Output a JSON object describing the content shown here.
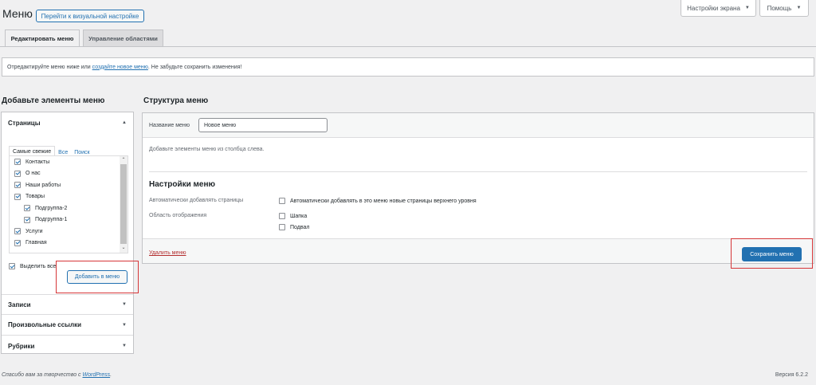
{
  "header": {
    "title": "Меню",
    "live_preview_button": "Перейти к визуальной настройке",
    "screen_options": "Настройки экрана",
    "help": "Помощь"
  },
  "tabs": [
    {
      "label": "Редактировать меню",
      "active": true
    },
    {
      "label": "Управление областями",
      "active": false
    }
  ],
  "notice": {
    "before": "Отредактируйте меню ниже или",
    "link": "создайте новое меню",
    "after": ". Не забудьте сохранить изменения!"
  },
  "left": {
    "heading": "Добавьте элементы меню",
    "pages_section": {
      "title": "Страницы",
      "tabs": [
        "Самые свежие",
        "Все",
        "Поиск"
      ],
      "items": [
        {
          "label": "Контакты",
          "checked": true,
          "level": 0
        },
        {
          "label": "О нас",
          "checked": true,
          "level": 0
        },
        {
          "label": "Наши работы",
          "checked": true,
          "level": 0
        },
        {
          "label": "Товары",
          "checked": true,
          "level": 0
        },
        {
          "label": "Подгруппа-2",
          "checked": true,
          "level": 1
        },
        {
          "label": "Подгруппа-1",
          "checked": true,
          "level": 1
        },
        {
          "label": "Услуги",
          "checked": true,
          "level": 0
        },
        {
          "label": "Главная",
          "checked": true,
          "level": 0
        }
      ],
      "select_all": "Выделить все",
      "add_button": "Добавить в меню"
    },
    "other_sections": [
      "Записи",
      "Произвольные ссылки",
      "Рубрики"
    ]
  },
  "right": {
    "heading": "Структура меню",
    "menu_name_label": "Название меню",
    "menu_name_value": "Новое меню",
    "instructions": "Добавьте элементы меню из столбца слева.",
    "settings_title": "Настройки меню",
    "auto_add_label": "Автоматически добавлять страницы",
    "auto_add_option": "Автоматически добавлять в это меню новые страницы верхнего уровня",
    "display_location_label": "Область отображения",
    "locations": [
      "Шапка",
      "Подвал"
    ],
    "delete_link": "Удалить меню",
    "save_button": "Сохранить меню"
  },
  "footer": {
    "thanks_before": "Спасибо вам за творчество с",
    "thanks_link": "WordPress",
    "thanks_after": ".",
    "version": "Версия 6.2.2"
  },
  "colors": {
    "accent": "#2271b1",
    "highlight_box": "#d63638",
    "danger_link": "#b32d2e"
  }
}
